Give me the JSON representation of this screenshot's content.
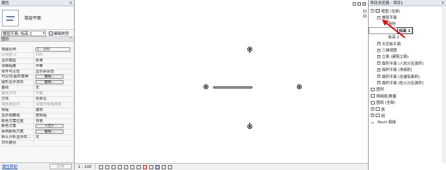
{
  "properties": {
    "title": "属性",
    "close": "×",
    "type_name": "楼层平面",
    "selector": "楼层平面: 标高 1",
    "edit_type": "编辑类型",
    "section_graphics": "图形",
    "rows": [
      {
        "k": "视图比例",
        "v": "1 : 100",
        "kind": "input"
      },
      {
        "k": "比例值 1:",
        "v": "100",
        "kind": "dim"
      },
      {
        "k": "显示模型",
        "v": "标准"
      },
      {
        "k": "详细程度",
        "v": "中等"
      },
      {
        "k": "零件可见性",
        "v": "显示原状态"
      },
      {
        "k": "可见性/图形替换",
        "v": "编辑...",
        "kind": "btn"
      },
      {
        "k": "图形显示选项",
        "v": "编辑...",
        "kind": "btn"
      },
      {
        "k": "基线",
        "v": "无"
      },
      {
        "k": "基线方向",
        "v": "平面",
        "kind": "dim"
      },
      {
        "k": "方向",
        "v": "项目北"
      },
      {
        "k": "墙连接显示",
        "v": "清理所有墙连接",
        "kind": "dim"
      },
      {
        "k": "规程",
        "v": "建筑"
      },
      {
        "k": "显示隐藏线",
        "v": "按规程"
      },
      {
        "k": "颜色方案位置",
        "v": "背景"
      },
      {
        "k": "颜色方案",
        "v": "<无>",
        "kind": "btn"
      },
      {
        "k": "系统颜色方案",
        "v": "编辑...",
        "kind": "btn"
      },
      {
        "k": "默认分析显示样...",
        "v": "无"
      },
      {
        "k": "日光路径",
        "v": ""
      }
    ],
    "help_link": "属性帮助",
    "apply": "应用"
  },
  "canvas": {
    "window_controls": [
      "-",
      "□",
      "×"
    ]
  },
  "status": {
    "scale": "1 : 100"
  },
  "browser": {
    "title": "项目浏览器 - 项目1",
    "close": "×",
    "items": [
      {
        "label": "视图 (全部)",
        "level": 0,
        "toggle": "−",
        "icon": "views"
      },
      {
        "label": "楼层平面",
        "level": 1,
        "toggle": "−"
      },
      {
        "label": "场地",
        "level": 2
      },
      {
        "label": "标高 1",
        "level": 2,
        "selected": true
      },
      {
        "label": "标高 2",
        "level": 2
      },
      {
        "label": "天花板平面",
        "level": 1,
        "toggle": "+"
      },
      {
        "label": "三维视图",
        "level": 1,
        "toggle": "+"
      },
      {
        "label": "立面 (建筑立面)",
        "level": 1,
        "toggle": "+"
      },
      {
        "label": "面积平面 (人防分区面积)",
        "level": 1,
        "toggle": "+"
      },
      {
        "label": "面积平面 (净面积)",
        "level": 1,
        "toggle": "+"
      },
      {
        "label": "面积平面 (总建筑面积)",
        "level": 1,
        "toggle": "+"
      },
      {
        "label": "面积平面 (防火分区面积)",
        "level": 1,
        "toggle": "+"
      },
      {
        "label": "图例",
        "level": 0,
        "icon": "doc"
      },
      {
        "label": "明细表/数量",
        "level": 0,
        "icon": "doc"
      },
      {
        "label": "图纸 (全部)",
        "level": 0,
        "icon": "doc"
      },
      {
        "label": "族",
        "level": 0,
        "toggle": "+",
        "icon": "doc"
      },
      {
        "label": "组",
        "level": 0,
        "toggle": "+",
        "icon": "doc"
      },
      {
        "label": "Revit 链接",
        "level": 0,
        "icon": "link"
      }
    ]
  },
  "colors": {
    "annotation_arrow": "#d01818",
    "selection_outline": "#333333"
  }
}
